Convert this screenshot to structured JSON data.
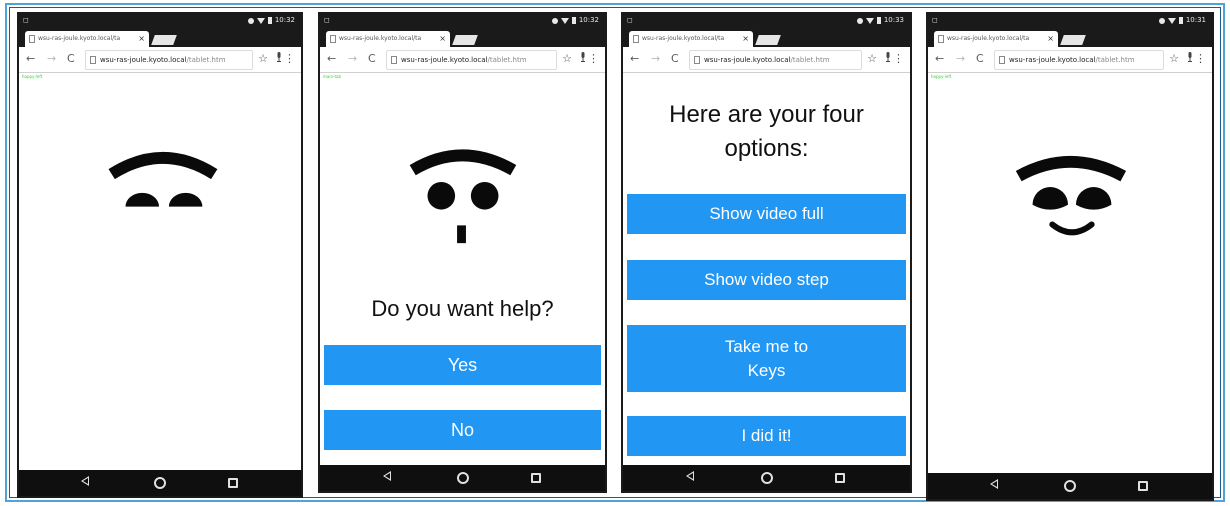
{
  "browser": {
    "tab_title": "wsu-ras-joule.kyoto.local/ta",
    "tab_close": "×",
    "url_host": "wsu-ras-joule.kyoto.local",
    "url_path": "/tablet.htm",
    "status_times": [
      "10:32",
      "10:32",
      "10:33",
      "10:31"
    ],
    "status_left_glyph": "◻",
    "back_glyph": "←",
    "forward_glyph": "→",
    "reload_glyph": "C",
    "star_glyph": "☆",
    "mic_glyph": "🎙",
    "menu_glyph": "⋮"
  },
  "screen_labels": {
    "p1": "happy-left",
    "p2": "main-tab",
    "p4": "happy-left"
  },
  "help_screen": {
    "question": "Do you want help?",
    "yes_label": "Yes",
    "no_label": "No"
  },
  "options_screen": {
    "heading_line1": "Here are your four",
    "heading_line2": "options:",
    "options": [
      "Show video full",
      "Show video step",
      "Take me to",
      "Keys",
      "I did it!"
    ]
  },
  "colors": {
    "accent_blue": "#2196f3",
    "frame_blue": "#4fa3d8",
    "status_green": "#39d13a",
    "face_black": "#0a0a0a"
  },
  "icons": {
    "nav": [
      "back-triangle-icon",
      "home-circle-icon",
      "recent-square-icon"
    ],
    "omnibox": [
      "back-arrow-icon",
      "forward-arrow-icon",
      "reload-icon",
      "star-icon",
      "mic-icon",
      "menu-icon"
    ]
  }
}
